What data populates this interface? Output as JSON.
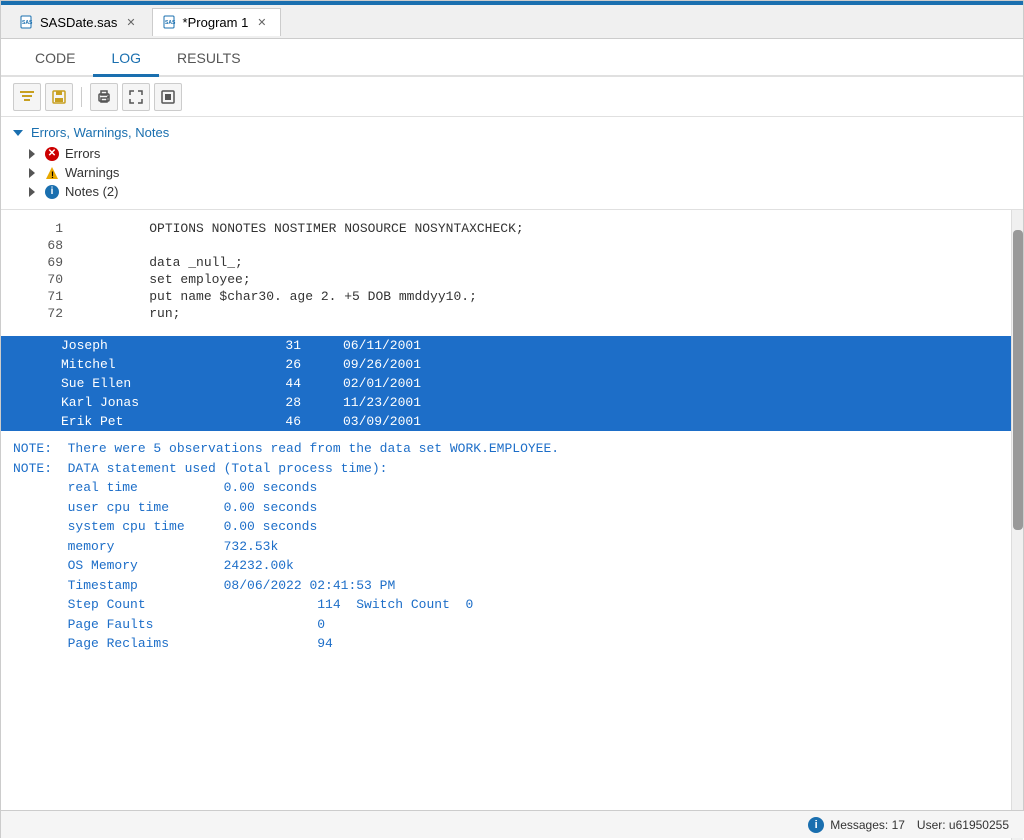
{
  "titleBar": {},
  "tabs": [
    {
      "label": "SASDate.sas",
      "active": false,
      "id": "tab-sasdate"
    },
    {
      "label": "*Program 1",
      "active": true,
      "id": "tab-program1"
    }
  ],
  "navTabs": [
    {
      "label": "CODE",
      "active": false
    },
    {
      "label": "LOG",
      "active": true
    },
    {
      "label": "RESULTS",
      "active": false
    }
  ],
  "toolbar": {
    "buttons": [
      "filter-icon",
      "save-icon",
      "print-icon",
      "expand-icon",
      "fullscreen-icon"
    ]
  },
  "tree": {
    "header": "Errors, Warnings, Notes",
    "items": [
      {
        "label": "Errors",
        "type": "error"
      },
      {
        "label": "Warnings",
        "type": "warning"
      },
      {
        "label": "Notes (2)",
        "type": "info"
      }
    ]
  },
  "codeLines": [
    {
      "num": "1",
      "code": "         OPTIONS NONOTES NOSTIMER NOSOURCE NOSYNTAXCHECK;"
    },
    {
      "num": "68",
      "code": ""
    },
    {
      "num": "69",
      "code": "         data _null_;"
    },
    {
      "num": "70",
      "code": "         set employee;"
    },
    {
      "num": "71",
      "code": "         put name $char30. age 2. +5 DOB mmddyy10.;"
    },
    {
      "num": "72",
      "code": "         run;"
    }
  ],
  "dataRows": [
    {
      "col1": "Joseph",
      "col2": "31",
      "col3": "06/11/2001"
    },
    {
      "col1": "Mitchel",
      "col2": "26",
      "col3": "09/26/2001"
    },
    {
      "col1": "Sue Ellen",
      "col2": "44",
      "col3": "02/01/2001"
    },
    {
      "col1": "Karl Jonas",
      "col2": "28",
      "col3": "11/23/2001"
    },
    {
      "col1": "Erik Pet",
      "col2": "46",
      "col3": "03/09/2001"
    }
  ],
  "notes": [
    "NOTE:  There were 5 observations read from the data set WORK.EMPLOYEE.",
    "NOTE:  DATA statement used (Total process time):",
    "       real time           0.00 seconds",
    "       user cpu time       0.00 seconds",
    "       system cpu time     0.00 seconds",
    "       memory              732.53k",
    "       OS Memory           24232.00k",
    "       Timestamp           08/06/2022 02:41:53 PM",
    "       Step Count                      114  Switch Count  0",
    "       Page Faults                     0",
    "       Page Reclaims                   94"
  ],
  "statusBar": {
    "messages": "Messages: 17",
    "user": "User: u61950255"
  }
}
